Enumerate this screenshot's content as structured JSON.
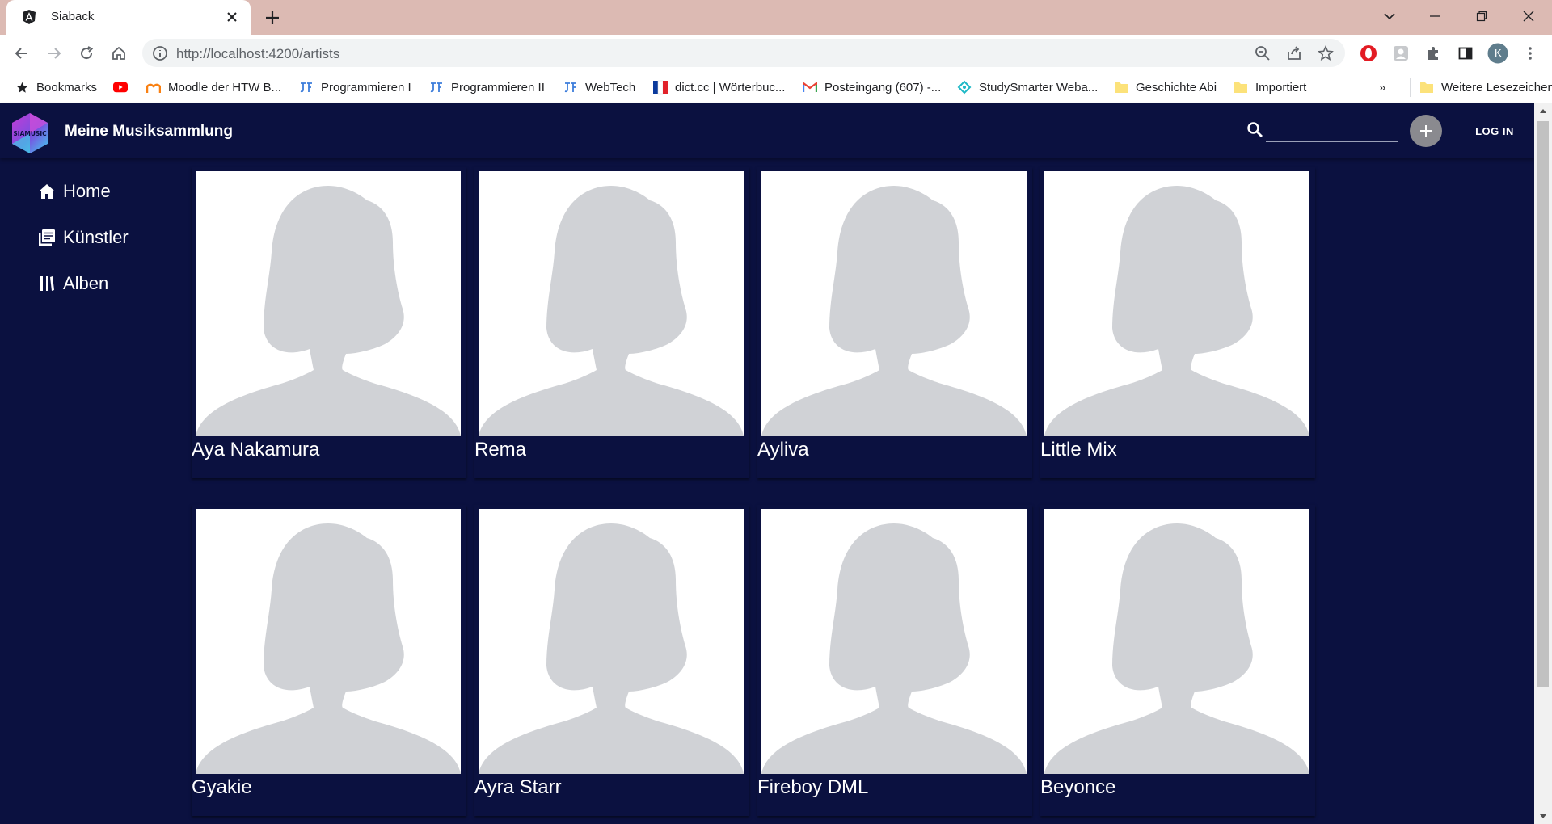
{
  "browser": {
    "tab_title": "Siaback",
    "url": "http://localhost:4200/artists",
    "profile_initial": "K",
    "bookmarks": [
      {
        "label": "Bookmarks",
        "icon": "star-icon"
      },
      {
        "label": "",
        "icon": "youtube-icon"
      },
      {
        "label": "Moodle der HTW B...",
        "icon": "moodle-icon"
      },
      {
        "label": "Programmieren I",
        "icon": "jf-icon"
      },
      {
        "label": "Programmieren II",
        "icon": "jf-icon"
      },
      {
        "label": "WebTech",
        "icon": "jf-icon"
      },
      {
        "label": "dict.cc | Wörterbuc...",
        "icon": "france-flag-icon"
      },
      {
        "label": "Posteingang (607) -...",
        "icon": "gmail-icon"
      },
      {
        "label": "StudySmarter Weba...",
        "icon": "studysmarter-icon"
      },
      {
        "label": "Geschichte Abi",
        "icon": "folder-icon"
      },
      {
        "label": "Importiert",
        "icon": "folder-icon"
      }
    ],
    "overflow_label": "»",
    "other_bookmarks": "Weitere Lesezeichen"
  },
  "app": {
    "title": "Meine Musiksammlung",
    "logo_text": "SIAMUSIC",
    "search_placeholder": "",
    "login_label": "LOG IN"
  },
  "nav": [
    {
      "label": "Home",
      "icon": "home-icon"
    },
    {
      "label": "Künstler",
      "icon": "library-icon"
    },
    {
      "label": "Alben",
      "icon": "album-icon"
    }
  ],
  "artists": [
    {
      "name": "Aya Nakamura"
    },
    {
      "name": "Rema"
    },
    {
      "name": "Ayliva"
    },
    {
      "name": "Little Mix"
    },
    {
      "name": "Gyakie"
    },
    {
      "name": "Ayra Starr"
    },
    {
      "name": "Fireboy DML"
    },
    {
      "name": "Beyonce"
    }
  ],
  "colors": {
    "app_background": "#0b1140",
    "tabstrip": "#dcbab3",
    "avatar_silhouette": "#d0d2d6"
  }
}
